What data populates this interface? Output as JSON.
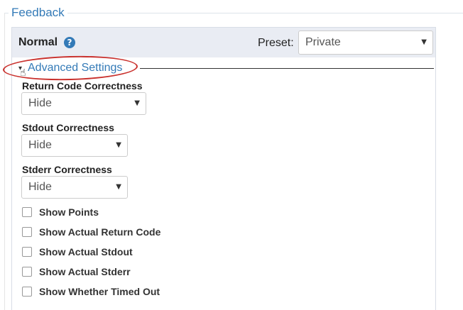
{
  "section": {
    "legend": "Feedback"
  },
  "panel": {
    "title": "Normal",
    "help_icon": "?",
    "preset_label": "Preset:",
    "preset_value": "Private"
  },
  "advanced": {
    "label": "Advanced Settings",
    "toggle_glyph": "▾",
    "annotation_color": "#c9302c"
  },
  "fields": {
    "return_code": {
      "label": "Return Code Correctness",
      "value": "Hide"
    },
    "stdout": {
      "label": "Stdout Correctness",
      "value": "Hide"
    },
    "stderr": {
      "label": "Stderr Correctness",
      "value": "Hide"
    }
  },
  "checkboxes": {
    "show_points": {
      "label": "Show Points",
      "checked": false
    },
    "show_return_code": {
      "label": "Show Actual Return Code",
      "checked": false
    },
    "show_stdout": {
      "label": "Show Actual Stdout",
      "checked": false
    },
    "show_stderr": {
      "label": "Show Actual Stderr",
      "checked": false
    },
    "show_timed_out": {
      "label": "Show Whether Timed Out",
      "checked": false
    }
  },
  "colors": {
    "link": "#337ab7",
    "header_bg": "#e9ecf3"
  }
}
